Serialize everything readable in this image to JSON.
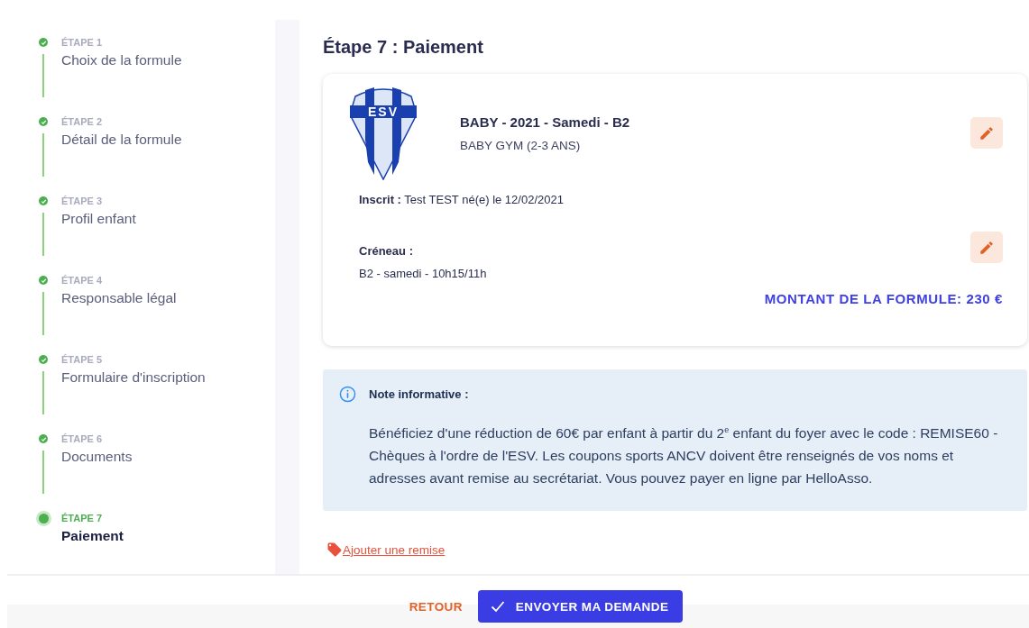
{
  "steps": [
    {
      "label": "ÉTAPE 1",
      "name": "Choix de la formule",
      "completed": true
    },
    {
      "label": "ÉTAPE 2",
      "name": "Détail de la formule",
      "completed": true
    },
    {
      "label": "ÉTAPE 3",
      "name": "Profil enfant",
      "completed": true
    },
    {
      "label": "ÉTAPE 4",
      "name": "Responsable légal",
      "completed": true
    },
    {
      "label": "ÉTAPE 5",
      "name": "Formulaire d'inscription",
      "completed": true
    },
    {
      "label": "ÉTAPE 6",
      "name": "Documents",
      "completed": true
    },
    {
      "label": "ÉTAPE 7",
      "name": "Paiement",
      "completed": false
    }
  ],
  "main": {
    "title": "Étape 7 : Paiement"
  },
  "card": {
    "logo_text": "ESV",
    "formula": "BABY - 2021 - Samedi - B2",
    "category": "BABY GYM (2-3 ANS)",
    "inscrit": "**Inscrit :** Test TEST né(e) le 12/02/2021",
    "creneau_label": "Créneau :",
    "creneau_value": "B2 - samedi - 10h15/11h",
    "amount": "MONTANT DE LA FORMULE: 230 €"
  },
  "note": {
    "title": "Note informative :",
    "text": "Bénéficiez d'une réduction de 60€ par enfant à partir du 2$^{e}$ enfant du foyer avec le code : REMISE60 - Chèques à l'ordre de l'ESV. Les coupons sports ANCV doivent être renseignés de vos noms et adresses avant remise au secrétariat. Vous pouvez payer en ligne par HelloAsso."
  },
  "discount_link": "Ajouter une remise",
  "footer": {
    "back": "RETOUR",
    "submit": "ENVOYER MA DEMANDE"
  }
}
